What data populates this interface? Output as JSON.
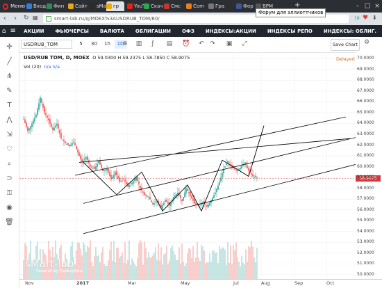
{
  "browser": {
    "menu_label": "Меню",
    "tabs": [
      {
        "label": "Вход",
        "color": "#3a7bd5"
      },
      {
        "label": "Фин",
        "color": "#2e8b57"
      },
      {
        "label": "Сайт",
        "color": "#e6a817"
      },
      {
        "label": "sMa",
        "color": "#2b2b2b"
      },
      {
        "label": "гр",
        "color": "#f2a900"
      },
      {
        "label": "YouT",
        "color": "#e62117"
      },
      {
        "label": "Скач",
        "color": "#2aa84a"
      },
      {
        "label": "Смс",
        "color": "#c0392b"
      },
      {
        "label": "Com",
        "color": "#e67e22"
      },
      {
        "label": "Гра",
        "color": "#777777"
      },
      {
        "label": "Фор",
        "color": "#3b5998"
      },
      {
        "label": "ВРМ",
        "color": "#555555"
      }
    ],
    "new_tab": "+",
    "tooltip": "Форум для эллиоттчиков",
    "url": "smart-lab.ru/q/MOEX%3AUSDRUB_TOM/60/",
    "badge": "18"
  },
  "sitenav": {
    "items": [
      "АКЦИИ",
      "ФЬЮЧЕРСЫ",
      "ВАЛЮТА",
      "ОБЛИГАЦИИ",
      "ОФЗ",
      "ИНДЕКСЫ:АКЦИИ",
      "ИНДЕКСЫ РЕПО",
      "ИНДЕКСЫ: ОБЛИГ."
    ]
  },
  "toolbar": {
    "symbol": "USDRUB_TOM",
    "timeframes": [
      "5",
      "30",
      "1h",
      "1D"
    ],
    "selected_timeframe": "1D",
    "save_label": "Save Chart"
  },
  "legend": {
    "title": "USD/RUB TOM, D, MOEX",
    "ohlc": "O 59.0300  H 59.2375  L 58.7850  C 58.9075",
    "vol_label": "Vol (20)",
    "vol_values": "n/a  n/a",
    "delayed": "Delayed"
  },
  "chart_data": {
    "type": "candlestick",
    "symbol": "USD/RUB TOM, D, MOEX",
    "y_ticks": [
      "70.0000",
      "69.0000",
      "68.0000",
      "67.0000",
      "66.0000",
      "65.0000",
      "64.0000",
      "63.0000",
      "62.0000",
      "61.0000",
      "60.0000",
      "59.0000",
      "58.0000",
      "57.0000",
      "56.0000",
      "55.0000",
      "54.0000",
      "53.0000",
      "52.0000",
      "51.0000",
      "50.0000"
    ],
    "ylim": [
      49.6,
      70.6
    ],
    "last_price": "58.9075",
    "x_ticks": [
      "Nov",
      "2017",
      "Mar",
      "May",
      "Jul",
      "Aug",
      "Sep",
      "Oct"
    ],
    "colors": {
      "up": "#26a69a",
      "down": "#ef5350",
      "drawing": "#000000",
      "price_line": "#e04040"
    }
  },
  "watermark": {
    "brand": "sMart-lab",
    "powered": "Powered by TradingView"
  }
}
